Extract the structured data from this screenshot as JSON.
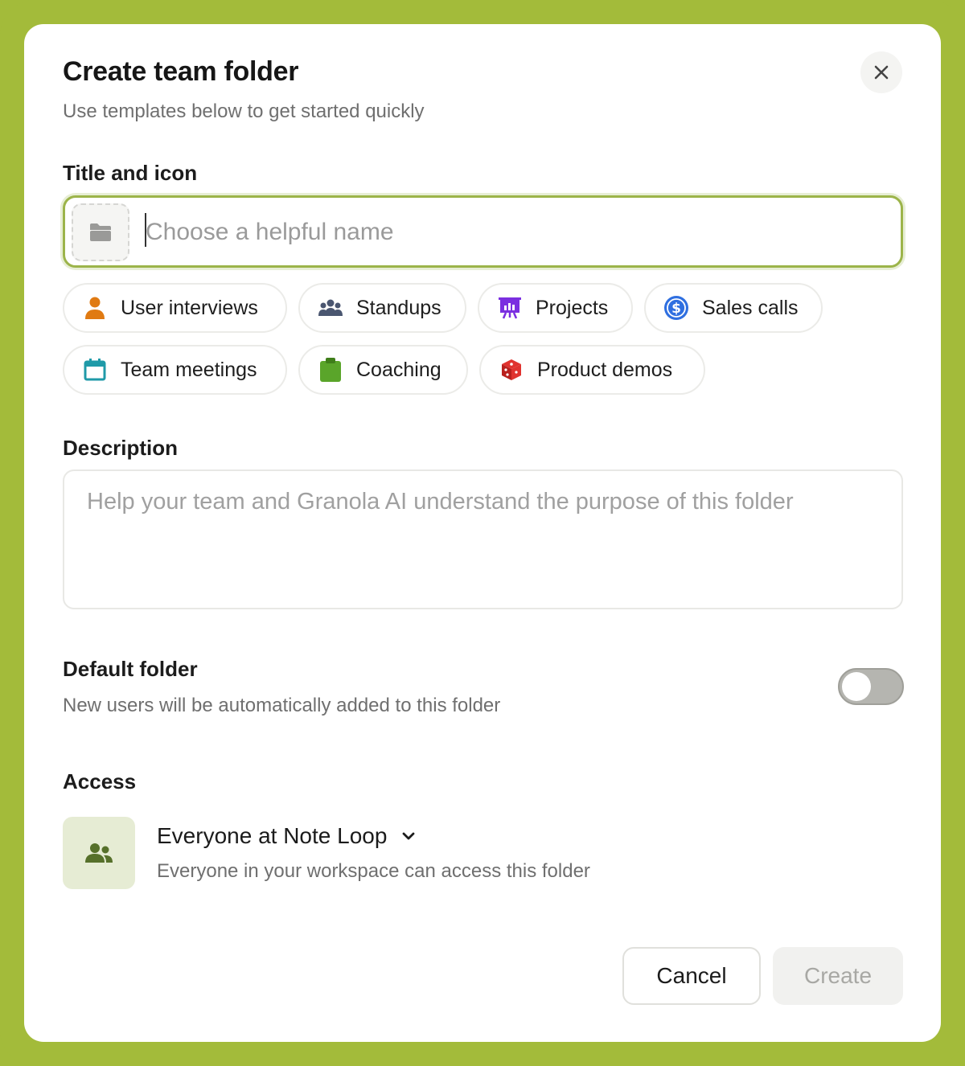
{
  "dialog": {
    "title": "Create team folder",
    "subtitle": "Use templates below to get started quickly",
    "close_icon": "close-icon"
  },
  "title_section": {
    "label": "Title and icon",
    "icon": "folder-icon",
    "placeholder": "Choose a helpful name",
    "value": ""
  },
  "templates": [
    {
      "label": "User interviews",
      "icon": "person-icon",
      "color": "#e07a12"
    },
    {
      "label": "Standups",
      "icon": "group-icon",
      "color": "#4a5670"
    },
    {
      "label": "Projects",
      "icon": "presentation-icon",
      "color": "#7b2fe0"
    },
    {
      "label": "Sales calls",
      "icon": "dollar-icon",
      "color": "#2f6fe0"
    },
    {
      "label": "Team meetings",
      "icon": "calendar-icon",
      "color": "#1f9aa8"
    },
    {
      "label": "Coaching",
      "icon": "clipboard-icon",
      "color": "#5aa52a"
    },
    {
      "label": "Product demos",
      "icon": "dice-icon",
      "color": "#e0332f"
    }
  ],
  "description": {
    "label": "Description",
    "placeholder": "Help your team and Granola AI understand the purpose of this folder",
    "value": ""
  },
  "default_folder": {
    "label": "Default folder",
    "help": "New users will be automatically added to this folder",
    "enabled": false
  },
  "access": {
    "label": "Access",
    "icon": "people-icon",
    "selected": "Everyone at Note Loop",
    "help": "Everyone in your workspace can access this folder"
  },
  "actions": {
    "cancel_label": "Cancel",
    "create_label": "Create"
  },
  "colors": {
    "background": "#a3bb3a",
    "focus_ring": "#9cb44a",
    "access_tile": "#e6ecd4"
  }
}
